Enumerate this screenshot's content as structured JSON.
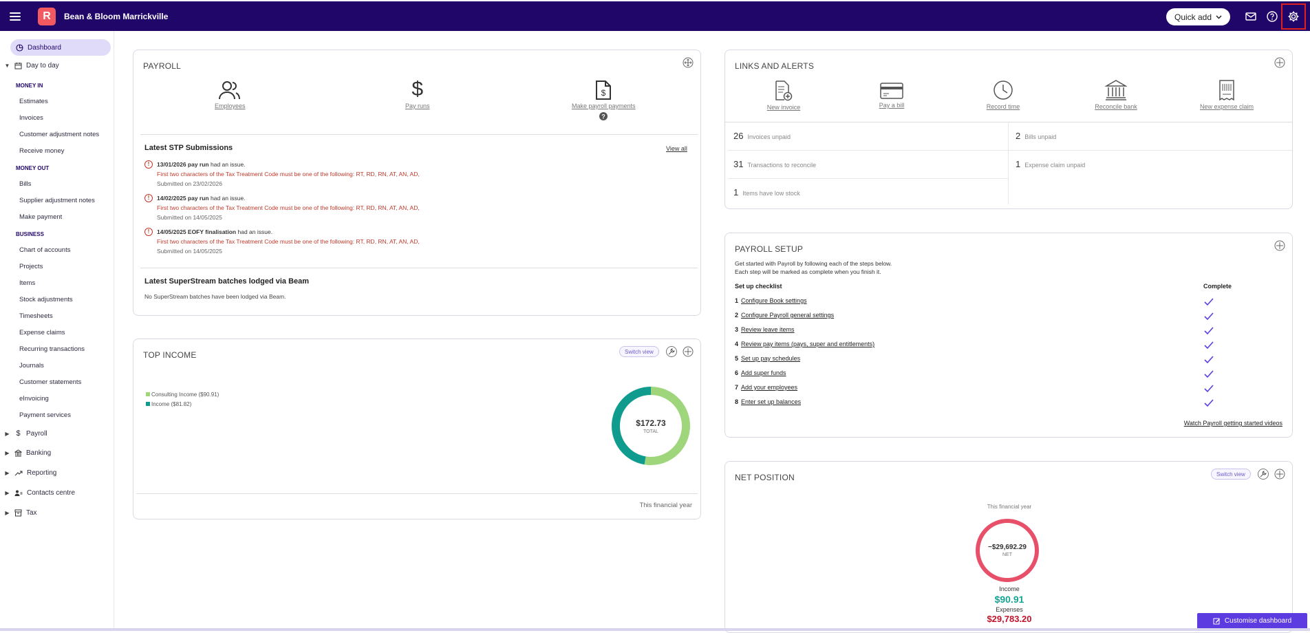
{
  "topbar": {
    "logo_letter": "R",
    "business_name": "Bean & Bloom Marrickville",
    "quick_add_label": "Quick add"
  },
  "sidebar": {
    "dashboard": "Dashboard",
    "day_to_day": "Day to day",
    "money_in": "MONEY IN",
    "money_in_items": [
      "Estimates",
      "Invoices",
      "Customer adjustment notes",
      "Receive money"
    ],
    "money_out": "MONEY OUT",
    "money_out_items": [
      "Bills",
      "Supplier adjustment notes",
      "Make payment"
    ],
    "business": "BUSINESS",
    "business_items": [
      "Chart of accounts",
      "Projects",
      "Items",
      "Stock adjustments",
      "Timesheets",
      "Expense claims",
      "Recurring transactions",
      "Journals",
      "Customer statements",
      "eInvoicing",
      "Payment services"
    ],
    "groups": [
      "Payroll",
      "Banking",
      "Reporting",
      "Contacts centre",
      "Tax"
    ]
  },
  "payroll": {
    "title": "PAYROLL",
    "employees": "Employees",
    "pay_runs": "Pay runs",
    "make_payments": "Make payroll payments",
    "stp_title": "Latest STP Submissions",
    "view_all": "View all",
    "submissions": [
      {
        "head": "13/01/2026 pay run",
        "tail": "had an issue.",
        "error": "First two characters of the Tax Treatment Code must be one of the following: RT, RD, RN, AT, AN, AD,",
        "submitted": "Submitted on 23/02/2026"
      },
      {
        "head": "14/02/2025 pay run",
        "tail": "had an issue.",
        "error": "First two characters of the Tax Treatment Code must be one of the following: RT, RD, RN, AT, AN, AD,",
        "submitted": "Submitted on 14/05/2025"
      },
      {
        "head": "14/05/2025 EOFY finalisation",
        "tail": "had an issue.",
        "error": "First two characters of the Tax Treatment Code must be one of the following: RT, RD, RN, AT, AN, AD,",
        "submitted": "Submitted on 14/05/2025"
      }
    ],
    "superstream_title": "Latest SuperStream batches lodged via Beam",
    "superstream_text": "No SuperStream batches have been lodged via Beam."
  },
  "top_income": {
    "title": "TOP INCOME",
    "switch_view": "Switch view",
    "legend": [
      "Consulting Income ($90.91)",
      "Income ($81.82)"
    ],
    "total": "$172.73",
    "total_label": "TOTAL",
    "footer": "This financial year",
    "colors": [
      "#9fd67c",
      "#0f9c8f"
    ]
  },
  "chart_data": {
    "type": "pie",
    "categories": [
      "Consulting Income",
      "Income"
    ],
    "values": [
      90.91,
      81.82
    ],
    "title": "TOP INCOME"
  },
  "links_alerts": {
    "title": "LINKS AND ALERTS",
    "links": [
      "New invoice",
      "Pay a bill",
      "Record time",
      "Reconcile bank",
      "New expense claim"
    ],
    "alerts": [
      {
        "num": "26",
        "label": "Invoices unpaid"
      },
      {
        "num": "2",
        "label": "Bills unpaid"
      },
      {
        "num": "31",
        "label": "Transactions to reconcile"
      },
      {
        "num": "1",
        "label": "Expense claim unpaid"
      },
      {
        "num": "1",
        "label": "Items have low stock"
      }
    ]
  },
  "payroll_setup": {
    "title": "PAYROLL SETUP",
    "intro1": "Get started with Payroll by following each of the steps below.",
    "intro2": "Each step will be marked as complete when you finish it.",
    "checklist_header": "Set up checklist",
    "complete_header": "Complete",
    "steps": [
      {
        "n": "1",
        "label": "Configure Book settings"
      },
      {
        "n": "2",
        "label": "Configure Payroll general settings"
      },
      {
        "n": "3",
        "label": "Review leave items"
      },
      {
        "n": "4",
        "label": "Review pay items (pays, super and entitlements)"
      },
      {
        "n": "5",
        "label": "Set up pay schedules"
      },
      {
        "n": "6",
        "label": "Add super funds"
      },
      {
        "n": "7",
        "label": "Add your employees"
      },
      {
        "n": "8",
        "label": "Enter set up balances"
      }
    ],
    "videos_link": "Watch Payroll getting started videos"
  },
  "net_position": {
    "title": "NET POSITION",
    "switch_view": "Switch view",
    "period": "This financial year",
    "net_value": "−$29,692.29",
    "net_label": "NET",
    "income_label": "Income",
    "income_value": "$90.91",
    "expenses_label": "Expenses",
    "expenses_value": "$29,783.20",
    "ring_color": "#e8506a",
    "income_color": "#16a394",
    "expenses_color": "#c0142b"
  },
  "footer": {
    "customise": "Customise dashboard"
  }
}
